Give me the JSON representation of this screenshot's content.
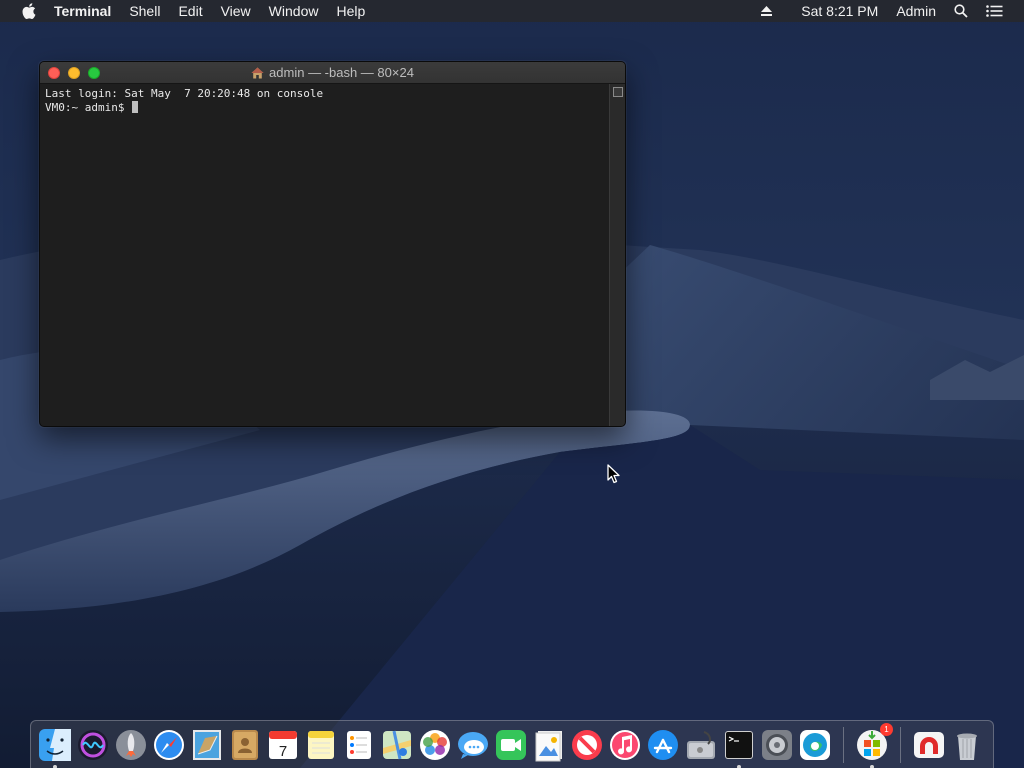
{
  "menubar": {
    "apple_icon": "apple-logo-icon",
    "app_name": "Terminal",
    "menus": [
      "Shell",
      "Edit",
      "View",
      "Window",
      "Help"
    ],
    "clock": "Sat 8:21 PM",
    "user": "Admin",
    "status_icons": [
      "eject-icon",
      "search-icon",
      "list-icon"
    ]
  },
  "terminal": {
    "title": "admin — -bash — 80×24",
    "title_icon": "home-icon",
    "lines": [
      "Last login: Sat May  7 20:20:48 on console",
      "VM0:~ admin$ "
    ]
  },
  "colors": {
    "close": "#fe5f57",
    "minimize": "#febc2e",
    "maximize": "#28c840",
    "terminal_bg": "#1e1e1e"
  },
  "dock": {
    "badge": "1",
    "items": [
      {
        "name": "finder-icon",
        "running": true
      },
      {
        "name": "siri-icon",
        "running": false
      },
      {
        "name": "launchpad-icon",
        "running": false
      },
      {
        "name": "safari-icon",
        "running": false
      },
      {
        "name": "mail-icon",
        "running": false
      },
      {
        "name": "contacts-icon",
        "running": false
      },
      {
        "name": "calendar-icon",
        "running": false
      },
      {
        "name": "notes-icon",
        "running": false
      },
      {
        "name": "reminders-icon",
        "running": false
      },
      {
        "name": "maps-icon",
        "running": false
      },
      {
        "name": "photos-icon",
        "running": false
      },
      {
        "name": "messages-icon",
        "running": false
      },
      {
        "name": "facetime-icon",
        "running": false
      },
      {
        "name": "preview-icon",
        "running": false
      },
      {
        "name": "news-icon",
        "running": false
      },
      {
        "name": "music-icon",
        "running": false
      },
      {
        "name": "app-store-icon",
        "running": false
      },
      {
        "name": "disk-utility-icon",
        "running": false
      },
      {
        "name": "terminal-icon",
        "running": true
      },
      {
        "name": "system-preferences-icon",
        "running": false
      },
      {
        "name": "edge-icon",
        "running": false
      },
      {
        "name": "office-installer-icon",
        "running": true
      },
      {
        "name": "magnet-icon",
        "running": false
      },
      {
        "name": "trash-icon",
        "running": false
      }
    ]
  }
}
